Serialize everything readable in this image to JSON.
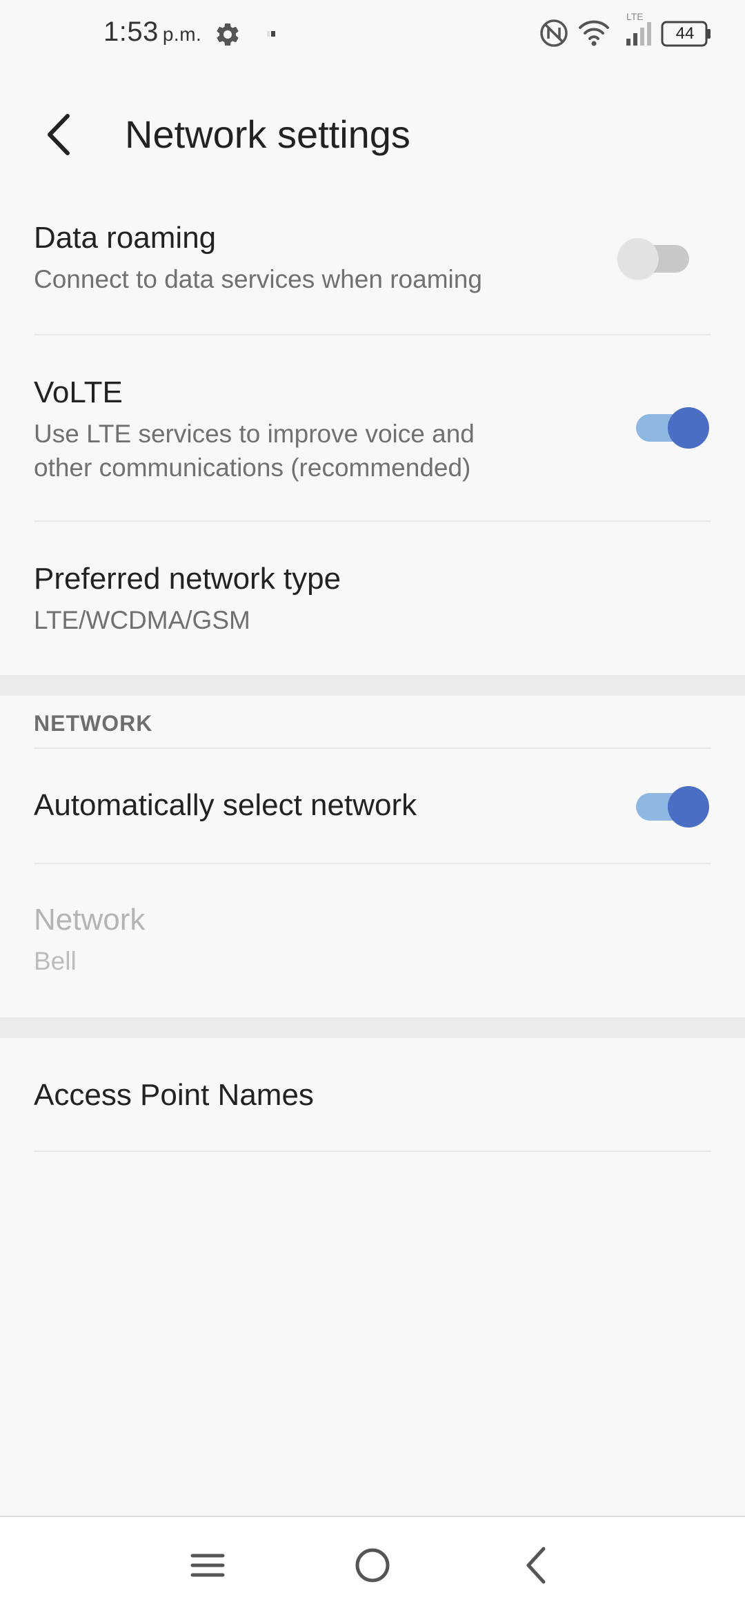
{
  "status_bar": {
    "time": "1:53",
    "ampm": "p.m.",
    "network_label": "LTE",
    "battery": "44",
    "icons": [
      "gear-icon",
      "notification-dot-icon",
      "nfc-icon",
      "wifi-icon",
      "signal-icon",
      "battery-icon"
    ]
  },
  "app_bar": {
    "title": "Network settings",
    "back_icon": "chevron-left-icon"
  },
  "settings": {
    "data_roaming": {
      "title": "Data roaming",
      "summary": "Connect to data services when roaming",
      "enabled": false
    },
    "volte": {
      "title": "VoLTE",
      "summary_line1": "Use LTE services to improve voice and",
      "summary_line2": "other communications (recommended)",
      "enabled": true
    },
    "preferred_network_type": {
      "title": "Preferred network type",
      "summary": "LTE/WCDMA/GSM"
    },
    "network_section": {
      "header": "NETWORK",
      "auto_select": {
        "title": "Automatically select network",
        "enabled": true
      },
      "network": {
        "title": "Network",
        "summary": "Bell",
        "disabled": true
      }
    },
    "apn": {
      "title": "Access Point Names"
    }
  },
  "nav_bar": {
    "icons": [
      "menu-icon",
      "home-icon",
      "back-icon"
    ]
  },
  "colors": {
    "accent": "#4a6ec4",
    "accent_track": "#8eb8e2",
    "background": "#f8f8f8",
    "divider_band": "#ebebeb"
  }
}
